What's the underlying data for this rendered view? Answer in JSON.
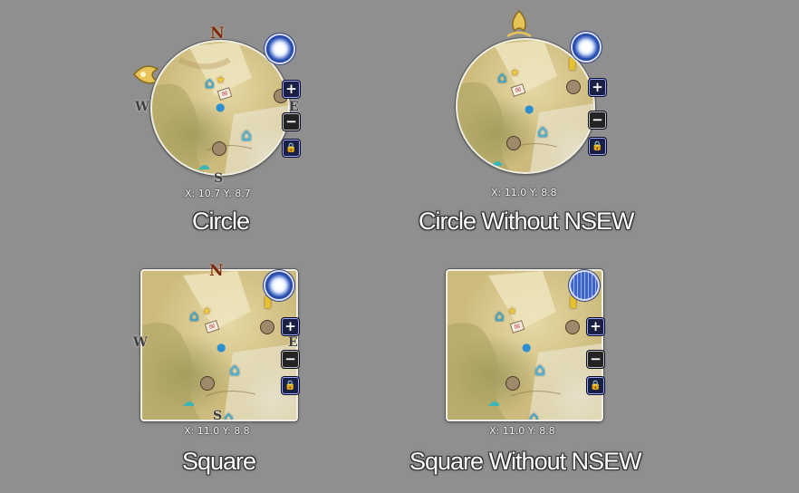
{
  "variants": [
    {
      "caption": "Circle",
      "coords": "X: 10.7 Y: 8.7",
      "shape": "circle",
      "compass": true
    },
    {
      "caption": "Circle Without NSEW",
      "coords": "X: 11.0 Y: 8.8",
      "shape": "circle",
      "compass": false
    },
    {
      "caption": "Square",
      "coords": "X: 11.0 Y: 8.8",
      "shape": "square",
      "compass": true
    },
    {
      "caption": "Square Without NSEW",
      "coords": "X: 11.0 Y: 8.8",
      "shape": "square",
      "compass": false
    }
  ],
  "compass_letters": {
    "n": "N",
    "s": "S",
    "e": "E",
    "w": "W"
  },
  "buttons": {
    "zoom_in": "+",
    "zoom_out": "−",
    "lock": "🔒"
  },
  "icons": {
    "weather_clear": "clear-weather-icon",
    "weather_rain": "rain-weather-icon",
    "home": "house-icon",
    "favorite": "star-icon",
    "mail": "letter-icon",
    "shop": "building-icon",
    "player": "player-icon",
    "pet": "pet-icon"
  },
  "colors": {
    "background": "#8f8f8f",
    "map_paper": "#e6d9a6",
    "button_fill": "#1a1f44",
    "north_letter": "#7a2a14",
    "caption_text": "#ffffff"
  }
}
